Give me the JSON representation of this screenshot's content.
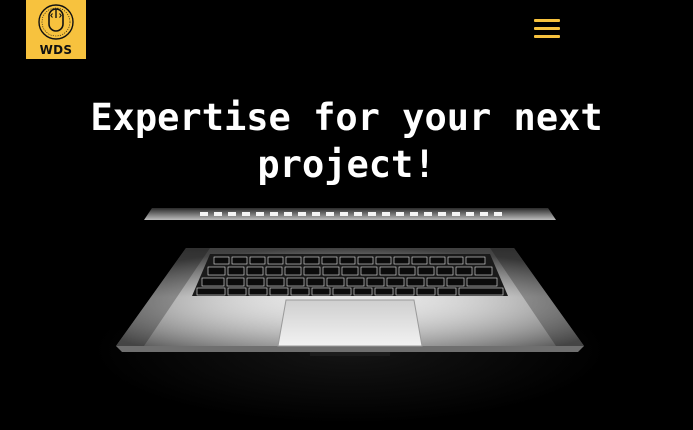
{
  "header": {
    "logo": {
      "text": "WDS",
      "ring_text": "WEB DEVELOPMENT SERVICES",
      "background": "#f7c23e",
      "icon": "mouse-icon"
    },
    "menu": {
      "icon": "hamburger-menu-icon",
      "color": "#f7c23e"
    }
  },
  "hero": {
    "title": "Expertise for your next project!",
    "image": "laptop-dark-photo"
  },
  "colors": {
    "background": "#000000",
    "accent": "#f7c23e",
    "title": "#ffffff"
  }
}
